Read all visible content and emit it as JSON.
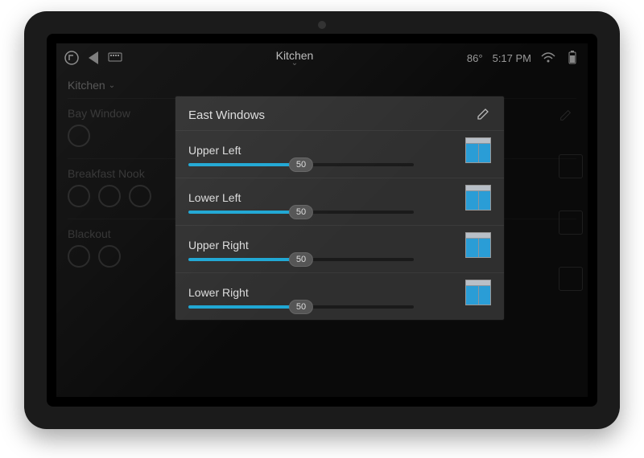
{
  "status": {
    "room": "Kitchen",
    "temp": "86°",
    "time": "5:17 PM"
  },
  "background": {
    "tab": "Kitchen",
    "rows": [
      {
        "label": "Bay Window"
      },
      {
        "label": "Breakfast Nook"
      },
      {
        "label": "Blackout"
      }
    ]
  },
  "panel": {
    "title": "East Windows",
    "sliders": [
      {
        "label": "Upper Left",
        "value": 50
      },
      {
        "label": "Lower Left",
        "value": 50
      },
      {
        "label": "Upper Right",
        "value": 50
      },
      {
        "label": "Lower Right",
        "value": 50
      }
    ]
  }
}
